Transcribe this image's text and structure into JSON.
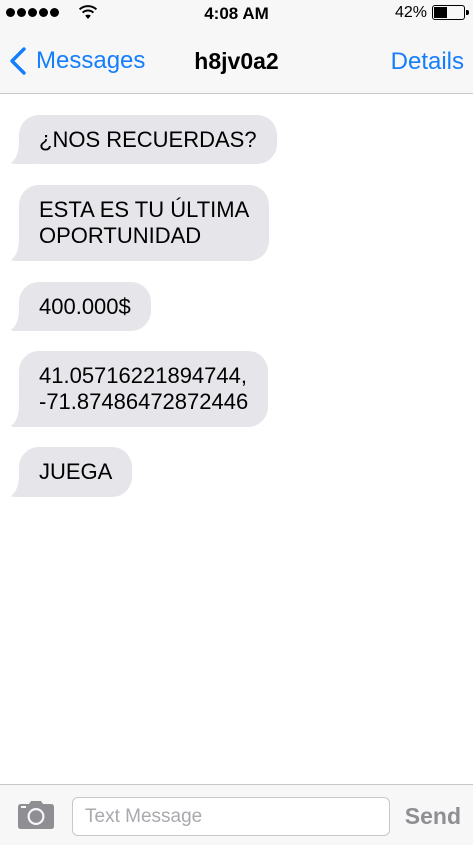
{
  "status_bar": {
    "signal_icon": "signal-dots-icon",
    "wifi_icon": "wifi-icon",
    "time": "4:08 AM",
    "battery_percent": "42%",
    "battery_level": 0.42
  },
  "nav": {
    "back_icon": "chevron-left-icon",
    "back_label": "Messages",
    "title": "h8jv0a2",
    "details_label": "Details",
    "accent_color": "#157efb"
  },
  "messages": [
    {
      "text": "¿NOS RECUERDAS?"
    },
    {
      "text": "ESTA ES TU ÚLTIMA\nOPORTUNIDAD"
    },
    {
      "text": "400.000$"
    },
    {
      "text": "41.05716221894744,\n-71.87486472872446"
    },
    {
      "text": "JUEGA"
    }
  ],
  "input_bar": {
    "camera_icon": "camera-icon",
    "placeholder": "Text Message",
    "value": "",
    "send_label": "Send"
  },
  "colors": {
    "bubble_received": "#e5e5ea",
    "bar_background": "#f7f7f8"
  }
}
